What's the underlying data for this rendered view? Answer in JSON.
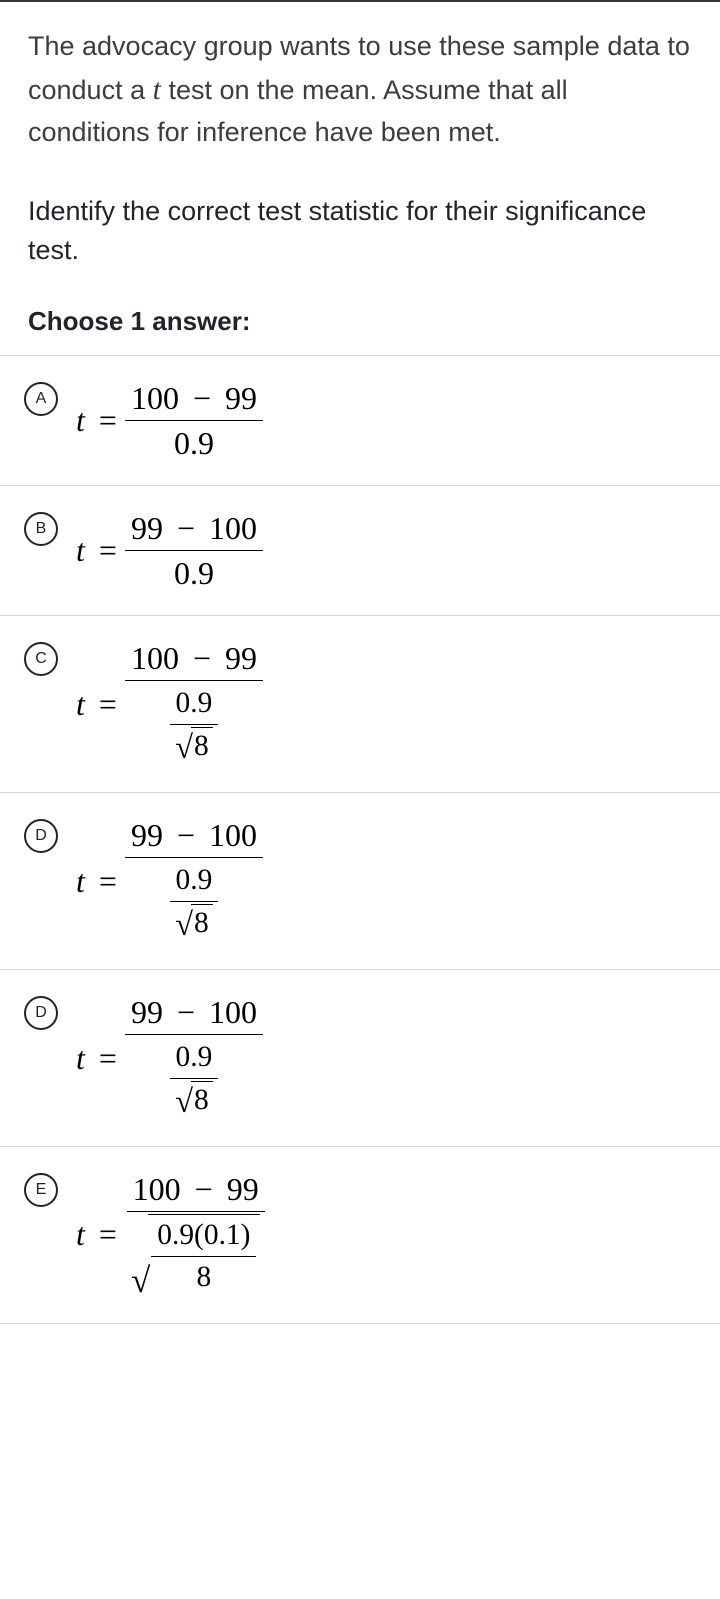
{
  "intro_pre": "The advocacy group wants to use these sample data to conduct a ",
  "intro_var": "t",
  "intro_post": " test on the mean. Assume that all conditions for inference have been met.",
  "prompt": "Identify the correct test statistic for their significance test.",
  "choose_label": "Choose 1 answer:",
  "options": [
    {
      "letter": "A",
      "num_a": "100",
      "num_b": "99",
      "den": "0.9",
      "sqrt_n": null,
      "variance_style": false
    },
    {
      "letter": "B",
      "num_a": "99",
      "num_b": "100",
      "den": "0.9",
      "sqrt_n": null,
      "variance_style": false
    },
    {
      "letter": "C",
      "num_a": "100",
      "num_b": "99",
      "den": "0.9",
      "sqrt_n": "8",
      "variance_style": false
    },
    {
      "letter": "D",
      "num_a": "99",
      "num_b": "100",
      "den": "0.9",
      "sqrt_n": "8",
      "variance_style": false
    },
    {
      "letter": "D",
      "num_a": "99",
      "num_b": "100",
      "den": "0.9",
      "sqrt_n": "8",
      "variance_style": false
    },
    {
      "letter": "E",
      "num_a": "100",
      "num_b": "99",
      "den_inner_num": "0.9(0.1)",
      "den_inner_den": "8",
      "variance_style": true
    }
  ],
  "symbols": {
    "t": "t",
    "equals": "=",
    "minus": "−"
  }
}
